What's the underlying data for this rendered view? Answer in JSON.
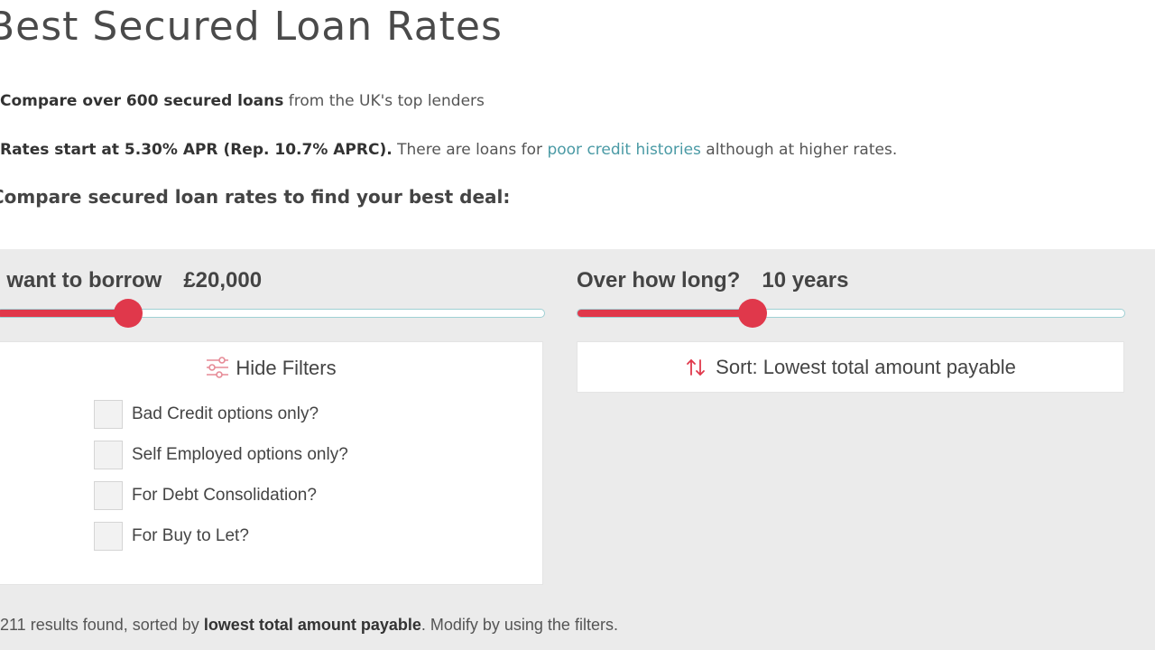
{
  "page": {
    "title": "Best Secured Loan Rates",
    "intro1_bold": "Compare over 600 secured loans",
    "intro1_rest": " from the UK's top lenders",
    "intro2_bold": "Rates start at 5.30% APR (Rep. 10.7% APRC).",
    "intro2_pre": " There are loans for ",
    "intro2_link": "poor credit histories",
    "intro2_post": " although at higher rates.",
    "compare_heading": "Compare secured loan rates to find your best deal:"
  },
  "borrow": {
    "label": "I want to borrow",
    "value": "£20,000",
    "position": 0.24
  },
  "term": {
    "label": "Over how long?",
    "value": "10 years",
    "position": 0.32
  },
  "filters": {
    "toggle_label": "Hide Filters",
    "options": [
      {
        "label": "Bad Credit options only?",
        "checked": false
      },
      {
        "label": "Self Employed options only?",
        "checked": false
      },
      {
        "label": "For Debt Consolidation?",
        "checked": false
      },
      {
        "label": "For Buy to Let?",
        "checked": false
      }
    ]
  },
  "sort": {
    "label": "Sort: Lowest total amount payable"
  },
  "results": {
    "count_text": "211 results found, sorted by ",
    "sort_bold": "lowest total amount payable",
    "suffix": ". Modify by using the filters."
  },
  "colors": {
    "accent": "#e0384b",
    "link": "#4a9aa5",
    "panel_bg": "#ebebeb",
    "track_border": "#9fd0d4"
  },
  "icons": {
    "filter": "sliders-icon",
    "sort": "sort-arrows-icon"
  }
}
